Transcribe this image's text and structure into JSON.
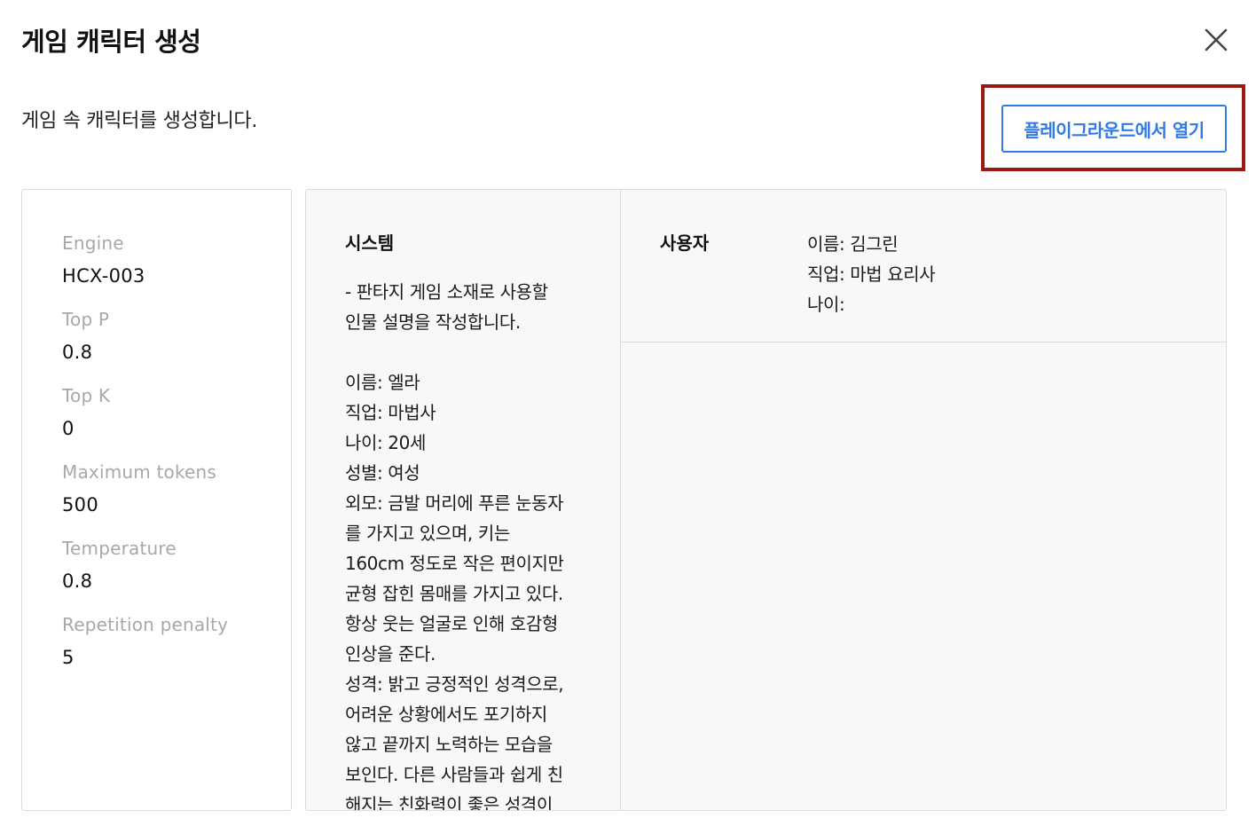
{
  "dialog": {
    "title": "게임 캐릭터 생성",
    "description": "게임 속 캐릭터를 생성합니다.",
    "open_playground_label": "플레이그라운드에서 열기",
    "close_icon": "close-icon"
  },
  "parameters": [
    {
      "label": "Engine",
      "value": "HCX-003"
    },
    {
      "label": "Top P",
      "value": "0.8"
    },
    {
      "label": "Top K",
      "value": "0"
    },
    {
      "label": "Maximum tokens",
      "value": "500"
    },
    {
      "label": "Temperature",
      "value": "0.8"
    },
    {
      "label": "Repetition penalty",
      "value": "5"
    }
  ],
  "system": {
    "heading": "시스템",
    "text": "- 판타지 게임 소재로 사용할\n인물 설명을 작성합니다.\n\n이름: 엘라\n직업: 마법사\n나이: 20세\n성별: 여성\n외모: 금발 머리에 푸른 눈동자\n를 가지고 있으며, 키는\n160cm 정도로 작은 편이지만\n균형 잡힌 몸매를 가지고 있다.\n항상 웃는 얼굴로 인해 호감형\n인상을 준다.\n성격: 밝고 긍정적인 성격으로,\n어려운 상황에서도 포기하지\n않고 끝까지 노력하는 모습을\n보인다. 다른 사람들과 쉽게 친\n해지는 친화력이 좋은 성격이"
  },
  "user": {
    "heading": "사용자",
    "text": "이름: 김그린\n직업: 마법 요리사\n나이:"
  },
  "colors": {
    "accent": "#2f7ae6",
    "highlight": "#9a1a12",
    "panel_border": "#dcdcdc",
    "chat_bg": "#f8f8f8",
    "muted_label": "#a8a8a8"
  }
}
